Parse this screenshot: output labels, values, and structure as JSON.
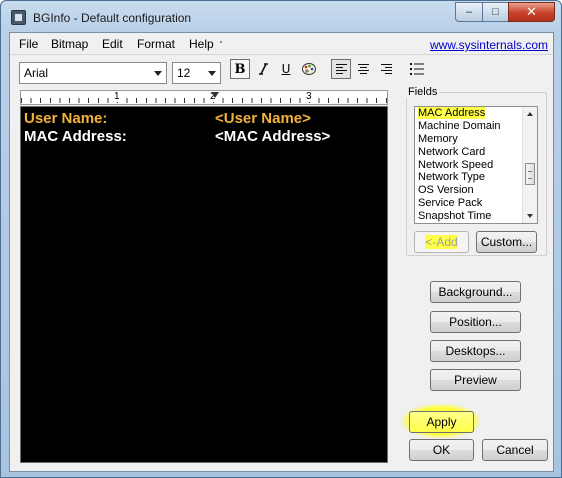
{
  "window": {
    "title": "BGInfo - Default configuration"
  },
  "caption": {
    "minimize": "–",
    "maximize": "□",
    "close": "✕"
  },
  "menu": {
    "items": [
      "File",
      "Bitmap",
      "Edit",
      "Format",
      "Help"
    ],
    "link": "www.sysinternals.com"
  },
  "toolbar": {
    "font": "Arial",
    "size": "12",
    "bold": "B",
    "underline": "U"
  },
  "ruler": {
    "numbers": [
      "1",
      "2",
      "3"
    ]
  },
  "editor": {
    "lines": [
      {
        "label": "User Name:",
        "value": "<User Name>",
        "color": "#f2b33d"
      },
      {
        "label": "MAC Address:",
        "value": "<MAC Address>",
        "color": "#ffffff"
      }
    ]
  },
  "fields": {
    "label": "Fields",
    "items": [
      "MAC Address",
      "Machine Domain",
      "Memory",
      "Network Card",
      "Network Speed",
      "Network Type",
      "OS Version",
      "Service Pack",
      "Snapshot Time"
    ],
    "selected": "MAC Address",
    "add": "<-Add",
    "custom": "Custom..."
  },
  "buttons": {
    "background": "Background...",
    "position": "Position...",
    "desktops": "Desktops...",
    "preview": "Preview",
    "apply": "Apply",
    "ok": "OK",
    "cancel": "Cancel"
  },
  "colors": {
    "highlight": "#ffff4a",
    "editor_bg": "#000000",
    "label_yellow": "#f2b33d"
  }
}
